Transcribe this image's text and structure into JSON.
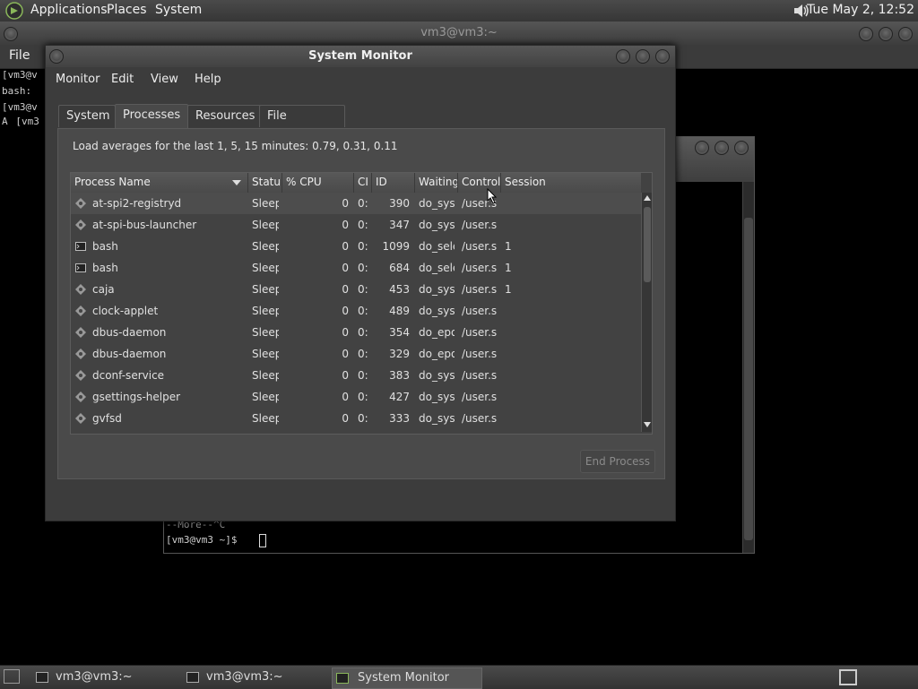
{
  "top_panel": {
    "menus": [
      "Applications",
      "Places",
      "System"
    ],
    "clock": "Tue May  2, 12:52"
  },
  "bg_terminal": {
    "title": "vm3@vm3:~",
    "menu_file": "File",
    "lines": [
      "[vm3@v",
      "bash:",
      "[vm3@v",
      "A[vm3"
    ]
  },
  "terminal2": {
    "lines": [
      "--More--^C",
      "[vm3@vm3 ~]$ "
    ]
  },
  "system_monitor": {
    "title": "System Monitor",
    "menu": [
      "Monitor",
      "Edit",
      "View",
      "Help"
    ],
    "tabs": [
      "System",
      "Processes",
      "Resources",
      "File Systems"
    ],
    "active_tab": "Processes",
    "load_averages": "Load averages for the last 1, 5, 15 minutes: 0.79, 0.31, 0.11",
    "columns": [
      "Process Name",
      "Statu",
      "% CPU",
      "CI",
      "ID",
      "Waiting",
      "Control",
      "Session"
    ],
    "rows": [
      {
        "name": "at-spi2-registryd",
        "status": "Sleep",
        "cpu": "0",
        "cpu_time": "0:",
        "id": "390",
        "waiting": "do_sys",
        "control": "/user.s",
        "session": "",
        "icon": "gear-icon"
      },
      {
        "name": "at-spi-bus-launcher",
        "status": "Sleep",
        "cpu": "0",
        "cpu_time": "0:",
        "id": "347",
        "waiting": "do_sys",
        "control": "/user.s",
        "session": "",
        "icon": "gear-icon"
      },
      {
        "name": "bash",
        "status": "Sleep",
        "cpu": "0",
        "cpu_time": "0:",
        "id": "1099",
        "waiting": "do_sele",
        "control": "/user.s",
        "session": "1",
        "icon": "terminal-icon"
      },
      {
        "name": "bash",
        "status": "Sleep",
        "cpu": "0",
        "cpu_time": "0:",
        "id": "684",
        "waiting": "do_sele",
        "control": "/user.s",
        "session": "1",
        "icon": "terminal-icon"
      },
      {
        "name": "caja",
        "status": "Sleep",
        "cpu": "0",
        "cpu_time": "0:",
        "id": "453",
        "waiting": "do_sys",
        "control": "/user.s",
        "session": "1",
        "icon": "gear-icon"
      },
      {
        "name": "clock-applet",
        "status": "Sleep",
        "cpu": "0",
        "cpu_time": "0:",
        "id": "489",
        "waiting": "do_sys",
        "control": "/user.s",
        "session": "",
        "icon": "gear-icon"
      },
      {
        "name": "dbus-daemon",
        "status": "Sleep",
        "cpu": "0",
        "cpu_time": "0:",
        "id": "354",
        "waiting": "do_epo",
        "control": "/user.s",
        "session": "",
        "icon": "gear-icon"
      },
      {
        "name": "dbus-daemon",
        "status": "Sleep",
        "cpu": "0",
        "cpu_time": "0:",
        "id": "329",
        "waiting": "do_epo",
        "control": "/user.s",
        "session": "",
        "icon": "gear-icon"
      },
      {
        "name": "dconf-service",
        "status": "Sleep",
        "cpu": "0",
        "cpu_time": "0:",
        "id": "383",
        "waiting": "do_sys",
        "control": "/user.s",
        "session": "",
        "icon": "gear-icon"
      },
      {
        "name": "gsettings-helper",
        "status": "Sleep",
        "cpu": "0",
        "cpu_time": "0:",
        "id": "427",
        "waiting": "do_sys",
        "control": "/user.s",
        "session": "",
        "icon": "gear-icon"
      },
      {
        "name": "gvfsd",
        "status": "Sleep",
        "cpu": "0",
        "cpu_time": "0:",
        "id": "333",
        "waiting": "do_sys",
        "control": "/user.s",
        "session": "",
        "icon": "gear-icon"
      }
    ],
    "end_process_label": "End Process"
  },
  "taskbar": {
    "tasks": [
      "vm3@vm3:~",
      "vm3@vm3:~",
      "System Monitor"
    ],
    "active_task": "System Monitor"
  }
}
